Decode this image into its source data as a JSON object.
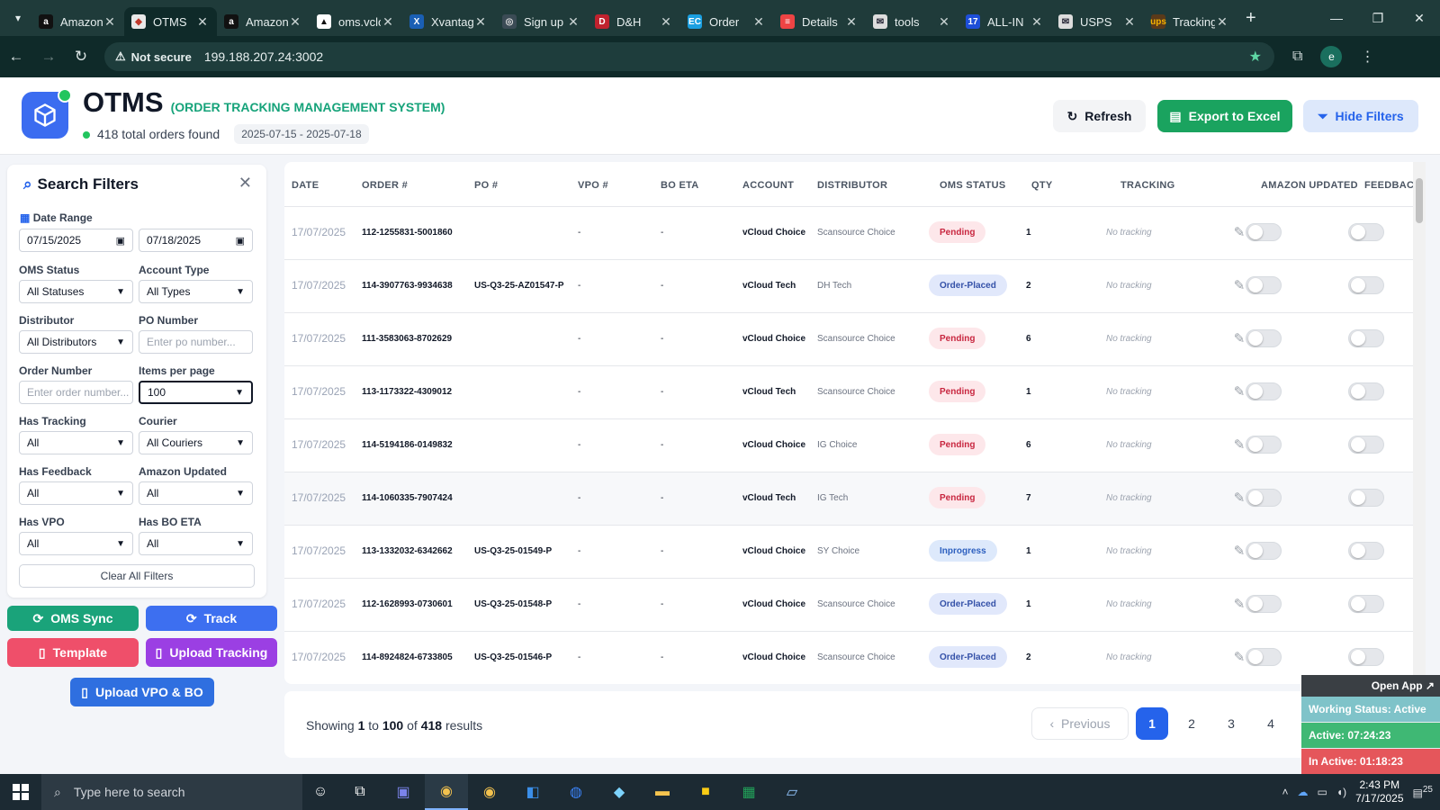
{
  "browser": {
    "tabs": [
      {
        "label": "Amazon",
        "fav": "a",
        "favbg": "#111111",
        "favfg": "#ffffff"
      },
      {
        "label": "OTMS",
        "fav": "◆",
        "favbg": "#e8e8e8",
        "favfg": "#c0392b",
        "active": true
      },
      {
        "label": "Amazon",
        "fav": "a",
        "favbg": "#111111",
        "favfg": "#ffffff"
      },
      {
        "label": "oms.vcloud",
        "fav": "▲",
        "favbg": "#ffffff",
        "favfg": "#111111"
      },
      {
        "label": "Xvantage",
        "fav": "X",
        "favbg": "#1a5fb4",
        "favfg": "#ffffff"
      },
      {
        "label": "Sign up",
        "fav": "◎",
        "favbg": "#3b4b55",
        "favfg": "#dddddd"
      },
      {
        "label": "D&H",
        "fav": "D",
        "favbg": "#c0222e",
        "favfg": "#ffffff"
      },
      {
        "label": "Order",
        "fav": "EC",
        "favbg": "#1a9fe0",
        "favfg": "#ffffff"
      },
      {
        "label": "Details",
        "fav": "≡",
        "favbg": "#e44",
        "favfg": "#ffffff"
      },
      {
        "label": "tools",
        "fav": "✉",
        "favbg": "#dddddd",
        "favfg": "#223"
      },
      {
        "label": "ALL-IN",
        "fav": "17",
        "favbg": "#1d4ed8",
        "favfg": "#ffffff"
      },
      {
        "label": "USPS",
        "fav": "✉",
        "favbg": "#dddddd",
        "favfg": "#223"
      },
      {
        "label": "Tracking",
        "fav": "ups",
        "favbg": "#5a3a1a",
        "favfg": "#f5b301"
      }
    ],
    "not_secure": "Not secure",
    "url": "199.188.207.24:3002",
    "profile": "e"
  },
  "header": {
    "title": "OTMS",
    "subtitle": "(ORDER TRACKING MANAGEMENT SYSTEM)",
    "orders_found": "418 total orders found",
    "date_range": "2025-07-15 - 2025-07-18",
    "refresh_label": "Refresh",
    "export_label": "Export to Excel",
    "hide_filters_label": "Hide Filters"
  },
  "filters": {
    "title": "Search Filters",
    "date_range_label": "Date Range",
    "date_from": "07/15/2025",
    "date_to": "07/18/2025",
    "oms_status_label": "OMS Status",
    "oms_status_value": "All Statuses",
    "account_type_label": "Account Type",
    "account_type_value": "All Types",
    "distributor_label": "Distributor",
    "distributor_value": "All Distributors",
    "po_number_label": "PO Number",
    "po_number_placeholder": "Enter po number...",
    "order_number_label": "Order Number",
    "order_number_placeholder": "Enter order number...",
    "items_per_page_label": "Items per page",
    "items_per_page_value": "100",
    "has_tracking_label": "Has Tracking",
    "has_tracking_value": "All",
    "courier_label": "Courier",
    "courier_value": "All Couriers",
    "has_feedback_label": "Has Feedback",
    "has_feedback_value": "All",
    "amazon_updated_label": "Amazon Updated",
    "amazon_updated_value": "All",
    "has_vpo_label": "Has VPO",
    "has_vpo_value": "All",
    "has_bo_eta_label": "Has BO ETA",
    "has_bo_eta_value": "All",
    "clear_label": "Clear All Filters"
  },
  "actions": {
    "oms_sync": "OMS Sync",
    "track": "Track",
    "template": "Template",
    "upload_tracking": "Upload Tracking",
    "upload_vpo_bo": "Upload VPO & BO"
  },
  "table": {
    "columns": [
      "DATE",
      "ORDER #",
      "PO #",
      "VPO #",
      "BO ETA",
      "ACCOUNT",
      "DISTRIBUTOR",
      "OMS STATUS",
      "QTY",
      "TRACKING",
      "AMAZON UPDATED",
      "FEEDBACK"
    ],
    "rows": [
      {
        "date": "17/07/2025",
        "order": "112-1255831-5001860",
        "po": "",
        "vpo": "-",
        "bo": "-",
        "account": "vCloud Choice",
        "distributor": "Scansource Choice",
        "status": "Pending",
        "qty": "1",
        "tracking": "No tracking"
      },
      {
        "date": "17/07/2025",
        "order": "114-3907763-9934638",
        "po": "US-Q3-25-AZ01547-P",
        "vpo": "-",
        "bo": "-",
        "account": "vCloud Tech",
        "distributor": "DH Tech",
        "status": "Order-Placed",
        "qty": "2",
        "tracking": "No tracking"
      },
      {
        "date": "17/07/2025",
        "order": "111-3583063-8702629",
        "po": "",
        "vpo": "-",
        "bo": "-",
        "account": "vCloud Choice",
        "distributor": "Scansource Choice",
        "status": "Pending",
        "qty": "6",
        "tracking": "No tracking"
      },
      {
        "date": "17/07/2025",
        "order": "113-1173322-4309012",
        "po": "",
        "vpo": "-",
        "bo": "-",
        "account": "vCloud Tech",
        "distributor": "Scansource Choice",
        "status": "Pending",
        "qty": "1",
        "tracking": "No tracking"
      },
      {
        "date": "17/07/2025",
        "order": "114-5194186-0149832",
        "po": "",
        "vpo": "-",
        "bo": "-",
        "account": "vCloud Choice",
        "distributor": "IG Choice",
        "status": "Pending",
        "qty": "6",
        "tracking": "No tracking"
      },
      {
        "date": "17/07/2025",
        "order": "114-1060335-7907424",
        "po": "",
        "vpo": "-",
        "bo": "-",
        "account": "vCloud Tech",
        "distributor": "IG Tech",
        "status": "Pending",
        "qty": "7",
        "tracking": "No tracking"
      },
      {
        "date": "17/07/2025",
        "order": "113-1332032-6342662",
        "po": "US-Q3-25-01549-P",
        "vpo": "-",
        "bo": "-",
        "account": "vCloud Choice",
        "distributor": "SY Choice",
        "status": "Inprogress",
        "qty": "1",
        "tracking": "No tracking"
      },
      {
        "date": "17/07/2025",
        "order": "112-1628993-0730601",
        "po": "US-Q3-25-01548-P",
        "vpo": "-",
        "bo": "-",
        "account": "vCloud Choice",
        "distributor": "Scansource Choice",
        "status": "Order-Placed",
        "qty": "1",
        "tracking": "No tracking"
      },
      {
        "date": "17/07/2025",
        "order": "114-8924824-6733805",
        "po": "US-Q3-25-01546-P",
        "vpo": "-",
        "bo": "-",
        "account": "vCloud Choice",
        "distributor": "Scansource Choice",
        "status": "Order-Placed",
        "qty": "2",
        "tracking": "No tracking"
      }
    ]
  },
  "pagination": {
    "showing_prefix": "Showing",
    "from": "1",
    "to_word": "to",
    "to": "100",
    "of_word": "of",
    "total": "418",
    "results_word": "results",
    "previous_label": "Previous",
    "pages": [
      "1",
      "2",
      "3",
      "4"
    ]
  },
  "widget": {
    "open_app": "Open App ↗",
    "working_status": "Working Status: Active",
    "active": "Active: 07:24:23",
    "inactive": "In Active: 01:18:23"
  },
  "taskbar": {
    "search_placeholder": "Type here to search",
    "time": "2:43 PM",
    "date": "7/17/2025",
    "notifications": "25"
  },
  "colors": {
    "accent_blue": "#2563eb",
    "export_green": "#1aa35f",
    "pending_red": "#c8263f",
    "brand_green": "#16a37a"
  }
}
